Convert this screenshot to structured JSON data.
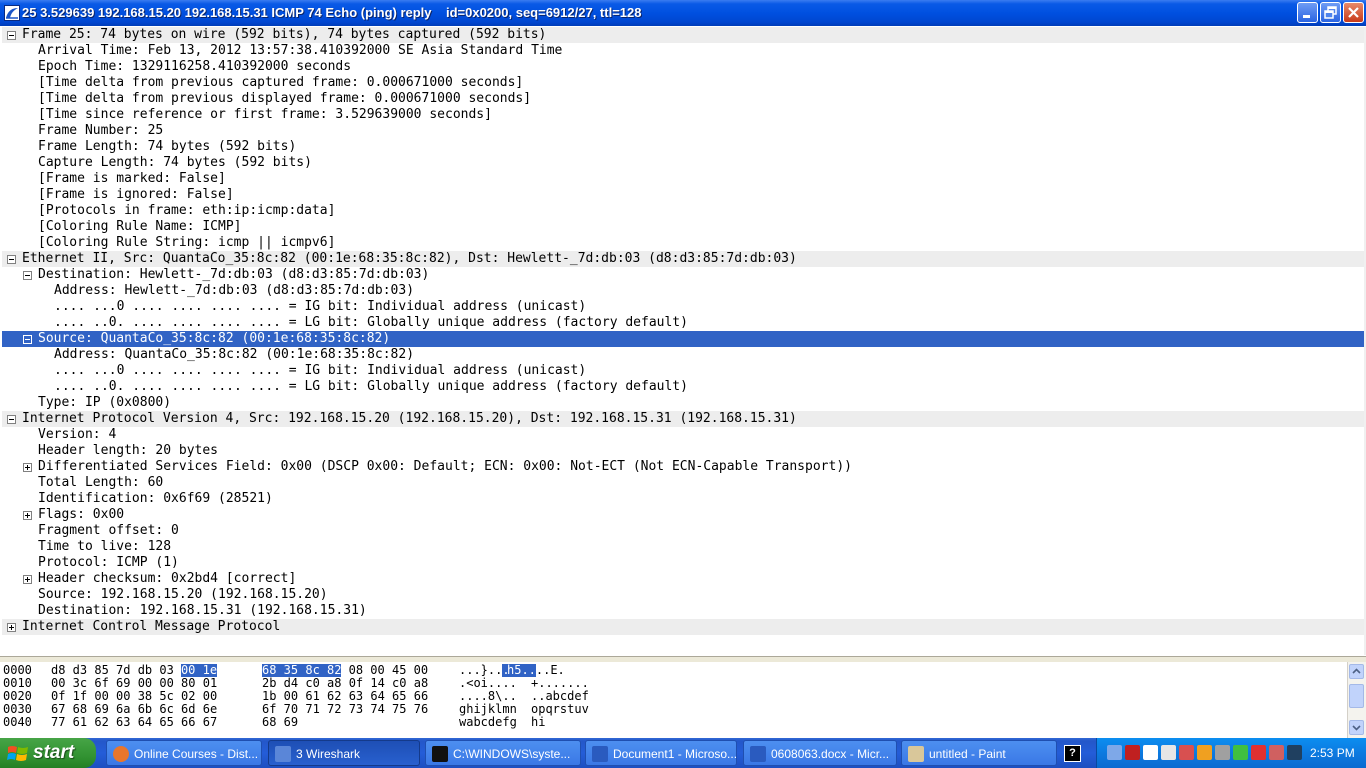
{
  "window": {
    "title": "25 3.529639 192.168.15.20 192.168.15.31 ICMP 74 Echo (ping) reply    id=0x0200, seq=6912/27, ttl=128"
  },
  "details": [
    {
      "text": "Frame 25: 74 bytes on wire (592 bits), 74 bytes captured (592 bits)",
      "level": 0,
      "expander": "minus",
      "header": true
    },
    {
      "text": "Arrival Time: Feb 13, 2012 13:57:38.410392000 SE Asia Standard Time",
      "level": 1
    },
    {
      "text": "Epoch Time: 1329116258.410392000 seconds",
      "level": 1
    },
    {
      "text": "[Time delta from previous captured frame: 0.000671000 seconds]",
      "level": 1
    },
    {
      "text": "[Time delta from previous displayed frame: 0.000671000 seconds]",
      "level": 1
    },
    {
      "text": "[Time since reference or first frame: 3.529639000 seconds]",
      "level": 1
    },
    {
      "text": "Frame Number: 25",
      "level": 1
    },
    {
      "text": "Frame Length: 74 bytes (592 bits)",
      "level": 1
    },
    {
      "text": "Capture Length: 74 bytes (592 bits)",
      "level": 1
    },
    {
      "text": "[Frame is marked: False]",
      "level": 1
    },
    {
      "text": "[Frame is ignored: False]",
      "level": 1
    },
    {
      "text": "[Protocols in frame: eth:ip:icmp:data]",
      "level": 1
    },
    {
      "text": "[Coloring Rule Name: ICMP]",
      "level": 1
    },
    {
      "text": "[Coloring Rule String: icmp || icmpv6]",
      "level": 1
    },
    {
      "text": "Ethernet II, Src: QuantaCo_35:8c:82 (00:1e:68:35:8c:82), Dst: Hewlett-_7d:db:03 (d8:d3:85:7d:db:03)",
      "level": 0,
      "expander": "minus",
      "header": true
    },
    {
      "text": "Destination: Hewlett-_7d:db:03 (d8:d3:85:7d:db:03)",
      "level": 1,
      "expander": "minus"
    },
    {
      "text": "Address: Hewlett-_7d:db:03 (d8:d3:85:7d:db:03)",
      "level": 2
    },
    {
      "text": ".... ...0 .... .... .... .... = IG bit: Individual address (unicast)",
      "level": 2
    },
    {
      "text": ".... ..0. .... .... .... .... = LG bit: Globally unique address (factory default)",
      "level": 2
    },
    {
      "text": "Source: QuantaCo_35:8c:82 (00:1e:68:35:8c:82)",
      "level": 1,
      "expander": "minus",
      "selected": true
    },
    {
      "text": "Address: QuantaCo_35:8c:82 (00:1e:68:35:8c:82)",
      "level": 2
    },
    {
      "text": ".... ...0 .... .... .... .... = IG bit: Individual address (unicast)",
      "level": 2
    },
    {
      "text": ".... ..0. .... .... .... .... = LG bit: Globally unique address (factory default)",
      "level": 2
    },
    {
      "text": "Type: IP (0x0800)",
      "level": 1
    },
    {
      "text": "Internet Protocol Version 4, Src: 192.168.15.20 (192.168.15.20), Dst: 192.168.15.31 (192.168.15.31)",
      "level": 0,
      "expander": "minus",
      "header": true
    },
    {
      "text": "Version: 4",
      "level": 1
    },
    {
      "text": "Header length: 20 bytes",
      "level": 1
    },
    {
      "text": "Differentiated Services Field: 0x00 (DSCP 0x00: Default; ECN: 0x00: Not-ECT (Not ECN-Capable Transport))",
      "level": 1,
      "expander": "plus"
    },
    {
      "text": "Total Length: 60",
      "level": 1
    },
    {
      "text": "Identification: 0x6f69 (28521)",
      "level": 1
    },
    {
      "text": "Flags: 0x00",
      "level": 1,
      "expander": "plus"
    },
    {
      "text": "Fragment offset: 0",
      "level": 1
    },
    {
      "text": "Time to live: 128",
      "level": 1
    },
    {
      "text": "Protocol: ICMP (1)",
      "level": 1
    },
    {
      "text": "Header checksum: 0x2bd4 [correct]",
      "level": 1,
      "expander": "plus"
    },
    {
      "text": "Source: 192.168.15.20 (192.168.15.20)",
      "level": 1
    },
    {
      "text": "Destination: 192.168.15.31 (192.168.15.31)",
      "level": 1
    },
    {
      "text": "Internet Control Message Protocol",
      "level": 0,
      "expander": "plus",
      "header": true
    }
  ],
  "hex": [
    {
      "offset": "0000",
      "h1": "d8 d3 85 7d db 03",
      "h1sel": "00 1e",
      "h2sel": "68 35 8c 82",
      "h2": "08 00 45 00",
      "a1": "...}..",
      "a1sel": "..",
      "a2sel": "h5..",
      "a2": "..E."
    },
    {
      "offset": "0010",
      "h1": "00 3c 6f 69 00 00 80 01",
      "h2": "2b d4 c0 a8 0f 14 c0 a8",
      "a1": ".<oi....",
      "a2": "+......."
    },
    {
      "offset": "0020",
      "h1": "0f 1f 00 00 38 5c 02 00",
      "h2": "1b 00 61 62 63 64 65 66",
      "a1": "....8\\..",
      "a2": "..abcdef"
    },
    {
      "offset": "0030",
      "h1": "67 68 69 6a 6b 6c 6d 6e",
      "h2": "6f 70 71 72 73 74 75 76",
      "a1": "ghijklmn",
      "a2": "opqrstuv"
    },
    {
      "offset": "0040",
      "h1": "77 61 62 63 64 65 66 67",
      "h2": "68 69",
      "a1": "wabcdefg",
      "a2": "hi"
    }
  ],
  "taskbar": {
    "start_label": "start",
    "tasks": [
      {
        "label": "Online Courses - Dist...",
        "icon": "firefox-icon",
        "active": false
      },
      {
        "label": "3 Wireshark",
        "icon": "wireshark-icon",
        "active": true
      },
      {
        "label": "C:\\WINDOWS\\syste...",
        "icon": "cmd-icon",
        "active": false
      },
      {
        "label": "Document1 - Microso...",
        "icon": "word-icon",
        "active": false
      },
      {
        "label": "0608063.docx - Micr...",
        "icon": "word-icon",
        "active": false
      },
      {
        "label": "untitled - Paint",
        "icon": "paint-icon",
        "active": false
      }
    ],
    "help_label": "?",
    "clock": "2:53 PM"
  },
  "colors": {
    "selection": "#3163c5",
    "header_row": "#ededed",
    "titlebar": "#0050e0",
    "taskbar": "#245dd8",
    "start_button": "#3c9c3c",
    "tray": "#0c7ae0"
  }
}
